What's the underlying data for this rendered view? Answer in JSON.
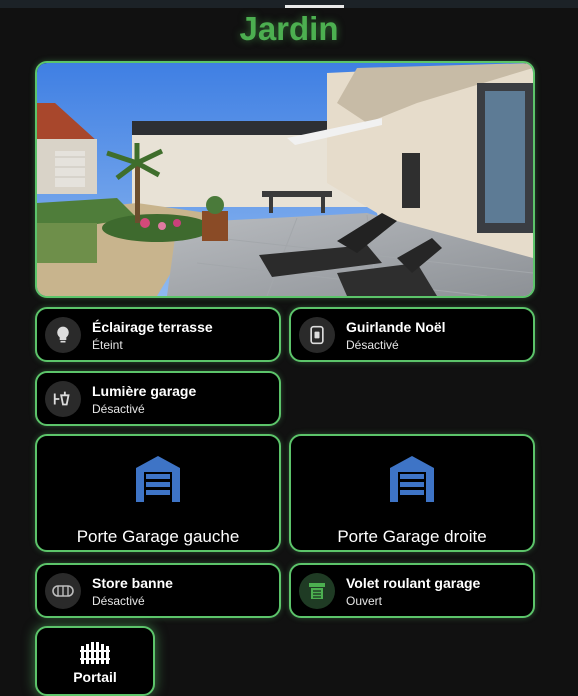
{
  "page": {
    "title": "Jardin"
  },
  "photo": {
    "icon": "garden-photo"
  },
  "tiles": [
    {
      "name": "Éclairage terrasse",
      "state": "Éteint",
      "icon": "lightbulb-icon"
    },
    {
      "name": "Guirlande Noël",
      "state": "Désactivé",
      "icon": "outlet-icon"
    },
    {
      "name": "Lumière garage",
      "state": "Désactivé",
      "icon": "wall-lamp-icon"
    },
    {
      "name": "Store banne",
      "state": "Désactivé",
      "icon": "awning-icon"
    },
    {
      "name": "Volet roulant garage",
      "state": "Ouvert",
      "icon": "roller-shutter-icon"
    }
  ],
  "garages": [
    {
      "label": "Porte Garage gauche",
      "icon": "garage-icon"
    },
    {
      "label": "Porte Garage droite",
      "icon": "garage-icon"
    }
  ],
  "portail": {
    "label": "Portail",
    "icon": "gate-icon"
  },
  "colors": {
    "accent": "#4caf50",
    "border": "#5cc46a",
    "garage_icon": "#3e74c6",
    "background": "#111111"
  }
}
